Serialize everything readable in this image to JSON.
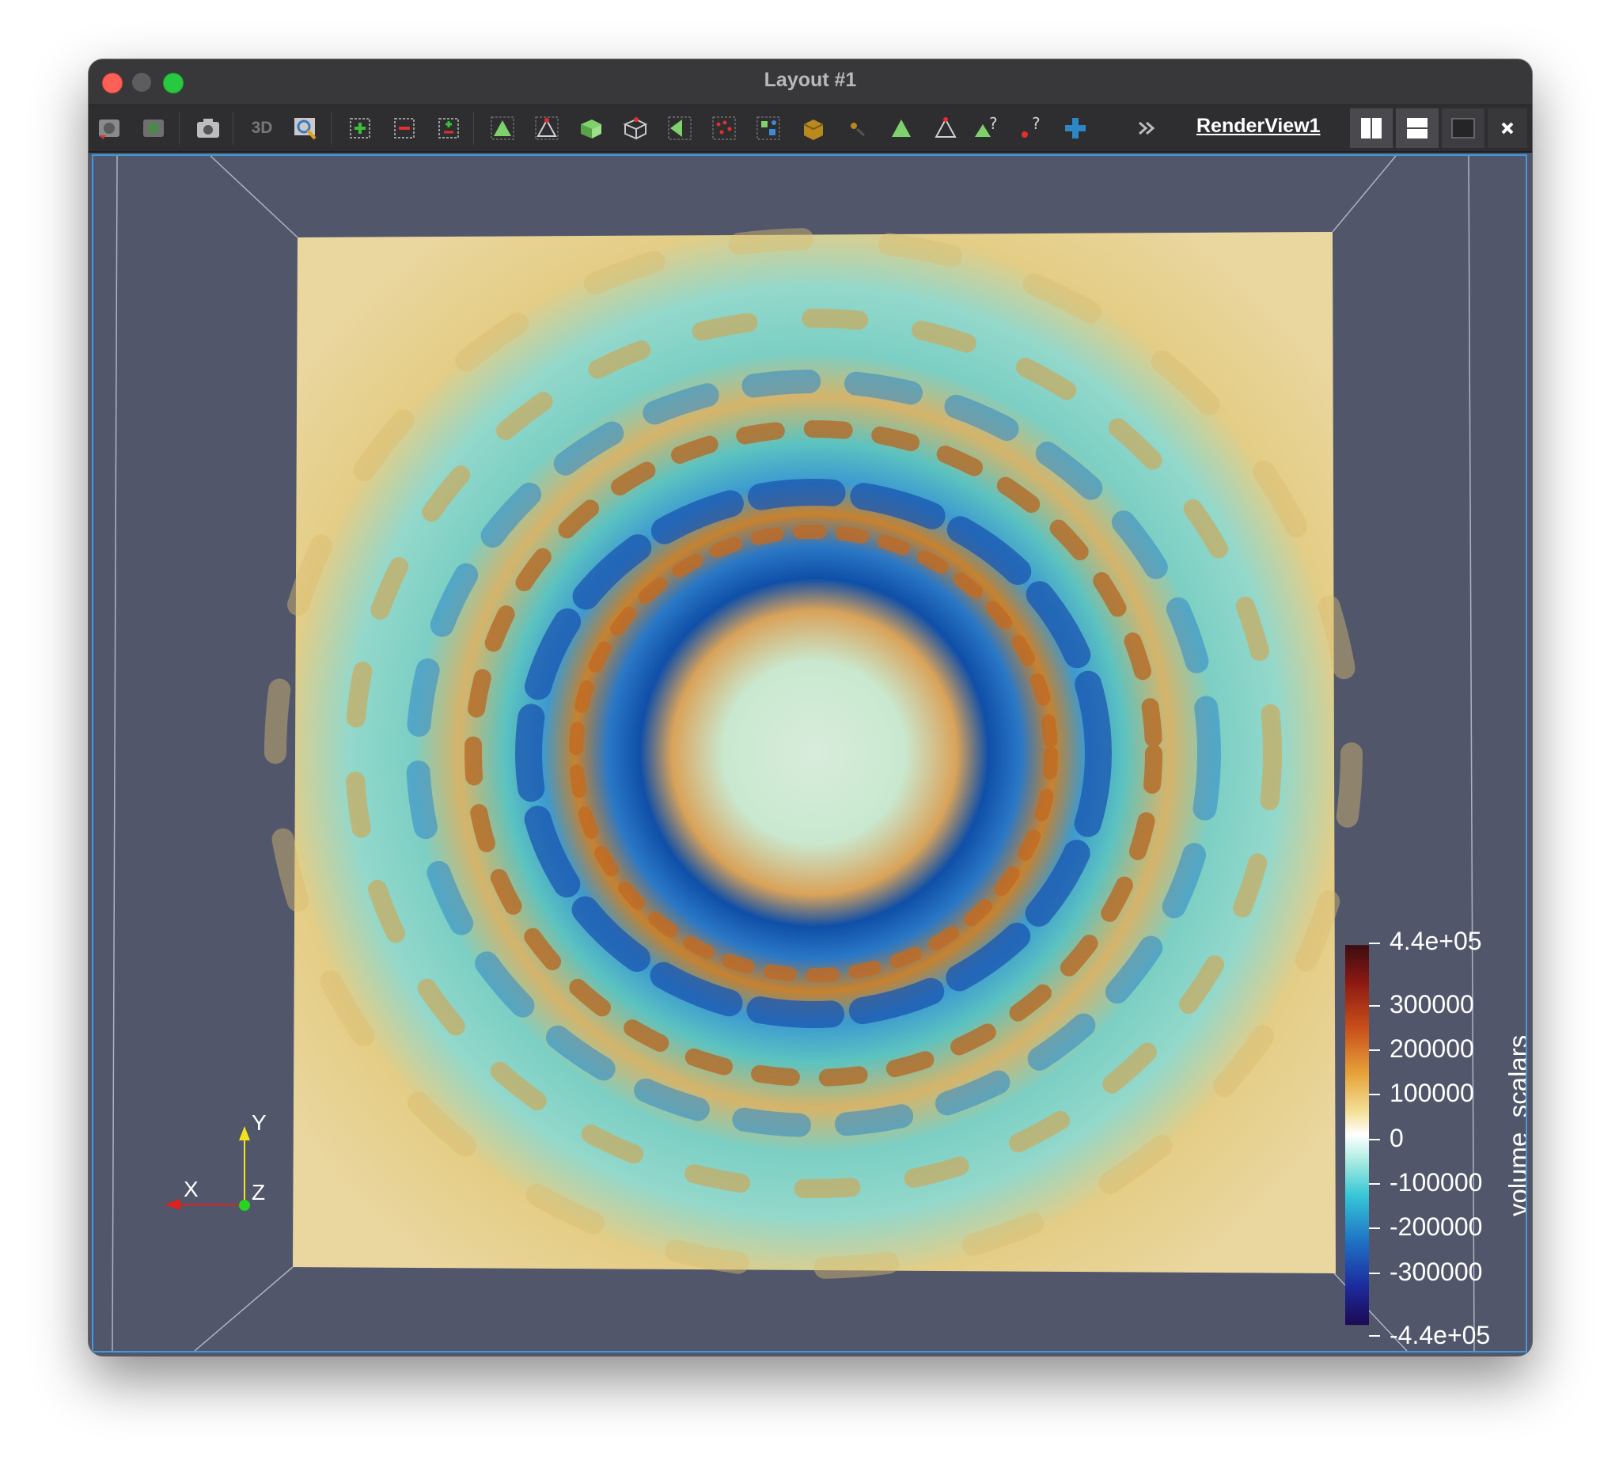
{
  "window": {
    "title": "Layout #1"
  },
  "toolbar": {
    "left_icons": [
      "reset-camera-icon",
      "reset-camera-closest-icon",
      "capture-screenshot-icon",
      "3d-toggle",
      "zoom-to-data-icon",
      "zoom-in-icon",
      "zoom-out-icon",
      "zoom-to-box-icon",
      "select-surface-cells-icon",
      "select-surface-points-icon",
      "select-frustum-cells-icon",
      "select-frustum-points-icon",
      "select-polygon-icon",
      "select-points-icon",
      "select-block-icon",
      "interactive-select-cells-icon",
      "interactive-select-points-icon",
      "hover-points-icon",
      "hover-cells-icon",
      "grow-selection-icon",
      "clear-selection-icon",
      "more-icon"
    ],
    "mode_3d_label": "3D",
    "view_name": "RenderView1",
    "right_icons": [
      "split-horizontal-icon",
      "split-vertical-icon",
      "maximize-icon",
      "close-icon"
    ]
  },
  "render_view": {
    "background_color": "#51566b",
    "colormap": "Turbo-like diverging (blue-white-red)",
    "color_bar": {
      "title": "volume_scalars",
      "range": [
        -440000,
        440000
      ],
      "top_label": "4.4e+05",
      "bottom_label": "-4.4e+05",
      "tick_labels": [
        "300000",
        "200000",
        "100000",
        "0",
        "-100000",
        "-200000",
        "-300000"
      ],
      "tick_values": [
        300000,
        200000,
        100000,
        0,
        -100000,
        -200000,
        -300000
      ]
    },
    "orientation_axes": {
      "x_label": "X",
      "y_label": "Y",
      "z_label": "Z",
      "x_color": "#e0221e",
      "y_color": "#f3e21b",
      "z_color": "#27d420"
    }
  }
}
